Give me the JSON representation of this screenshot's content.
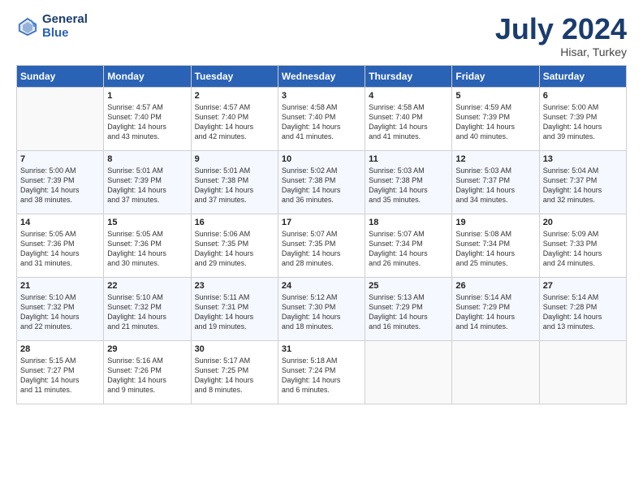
{
  "header": {
    "logo_line1": "General",
    "logo_line2": "Blue",
    "month_title": "July 2024",
    "subtitle": "Hisar, Turkey"
  },
  "days_of_week": [
    "Sunday",
    "Monday",
    "Tuesday",
    "Wednesday",
    "Thursday",
    "Friday",
    "Saturday"
  ],
  "weeks": [
    [
      {
        "day": "",
        "content": ""
      },
      {
        "day": "1",
        "content": "Sunrise: 4:57 AM\nSunset: 7:40 PM\nDaylight: 14 hours\nand 43 minutes."
      },
      {
        "day": "2",
        "content": "Sunrise: 4:57 AM\nSunset: 7:40 PM\nDaylight: 14 hours\nand 42 minutes."
      },
      {
        "day": "3",
        "content": "Sunrise: 4:58 AM\nSunset: 7:40 PM\nDaylight: 14 hours\nand 41 minutes."
      },
      {
        "day": "4",
        "content": "Sunrise: 4:58 AM\nSunset: 7:40 PM\nDaylight: 14 hours\nand 41 minutes."
      },
      {
        "day": "5",
        "content": "Sunrise: 4:59 AM\nSunset: 7:39 PM\nDaylight: 14 hours\nand 40 minutes."
      },
      {
        "day": "6",
        "content": "Sunrise: 5:00 AM\nSunset: 7:39 PM\nDaylight: 14 hours\nand 39 minutes."
      }
    ],
    [
      {
        "day": "7",
        "content": "Sunrise: 5:00 AM\nSunset: 7:39 PM\nDaylight: 14 hours\nand 38 minutes."
      },
      {
        "day": "8",
        "content": "Sunrise: 5:01 AM\nSunset: 7:39 PM\nDaylight: 14 hours\nand 37 minutes."
      },
      {
        "day": "9",
        "content": "Sunrise: 5:01 AM\nSunset: 7:38 PM\nDaylight: 14 hours\nand 37 minutes."
      },
      {
        "day": "10",
        "content": "Sunrise: 5:02 AM\nSunset: 7:38 PM\nDaylight: 14 hours\nand 36 minutes."
      },
      {
        "day": "11",
        "content": "Sunrise: 5:03 AM\nSunset: 7:38 PM\nDaylight: 14 hours\nand 35 minutes."
      },
      {
        "day": "12",
        "content": "Sunrise: 5:03 AM\nSunset: 7:37 PM\nDaylight: 14 hours\nand 34 minutes."
      },
      {
        "day": "13",
        "content": "Sunrise: 5:04 AM\nSunset: 7:37 PM\nDaylight: 14 hours\nand 32 minutes."
      }
    ],
    [
      {
        "day": "14",
        "content": "Sunrise: 5:05 AM\nSunset: 7:36 PM\nDaylight: 14 hours\nand 31 minutes."
      },
      {
        "day": "15",
        "content": "Sunrise: 5:05 AM\nSunset: 7:36 PM\nDaylight: 14 hours\nand 30 minutes."
      },
      {
        "day": "16",
        "content": "Sunrise: 5:06 AM\nSunset: 7:35 PM\nDaylight: 14 hours\nand 29 minutes."
      },
      {
        "day": "17",
        "content": "Sunrise: 5:07 AM\nSunset: 7:35 PM\nDaylight: 14 hours\nand 28 minutes."
      },
      {
        "day": "18",
        "content": "Sunrise: 5:07 AM\nSunset: 7:34 PM\nDaylight: 14 hours\nand 26 minutes."
      },
      {
        "day": "19",
        "content": "Sunrise: 5:08 AM\nSunset: 7:34 PM\nDaylight: 14 hours\nand 25 minutes."
      },
      {
        "day": "20",
        "content": "Sunrise: 5:09 AM\nSunset: 7:33 PM\nDaylight: 14 hours\nand 24 minutes."
      }
    ],
    [
      {
        "day": "21",
        "content": "Sunrise: 5:10 AM\nSunset: 7:32 PM\nDaylight: 14 hours\nand 22 minutes."
      },
      {
        "day": "22",
        "content": "Sunrise: 5:10 AM\nSunset: 7:32 PM\nDaylight: 14 hours\nand 21 minutes."
      },
      {
        "day": "23",
        "content": "Sunrise: 5:11 AM\nSunset: 7:31 PM\nDaylight: 14 hours\nand 19 minutes."
      },
      {
        "day": "24",
        "content": "Sunrise: 5:12 AM\nSunset: 7:30 PM\nDaylight: 14 hours\nand 18 minutes."
      },
      {
        "day": "25",
        "content": "Sunrise: 5:13 AM\nSunset: 7:29 PM\nDaylight: 14 hours\nand 16 minutes."
      },
      {
        "day": "26",
        "content": "Sunrise: 5:14 AM\nSunset: 7:29 PM\nDaylight: 14 hours\nand 14 minutes."
      },
      {
        "day": "27",
        "content": "Sunrise: 5:14 AM\nSunset: 7:28 PM\nDaylight: 14 hours\nand 13 minutes."
      }
    ],
    [
      {
        "day": "28",
        "content": "Sunrise: 5:15 AM\nSunset: 7:27 PM\nDaylight: 14 hours\nand 11 minutes."
      },
      {
        "day": "29",
        "content": "Sunrise: 5:16 AM\nSunset: 7:26 PM\nDaylight: 14 hours\nand 9 minutes."
      },
      {
        "day": "30",
        "content": "Sunrise: 5:17 AM\nSunset: 7:25 PM\nDaylight: 14 hours\nand 8 minutes."
      },
      {
        "day": "31",
        "content": "Sunrise: 5:18 AM\nSunset: 7:24 PM\nDaylight: 14 hours\nand 6 minutes."
      },
      {
        "day": "",
        "content": ""
      },
      {
        "day": "",
        "content": ""
      },
      {
        "day": "",
        "content": ""
      }
    ]
  ]
}
